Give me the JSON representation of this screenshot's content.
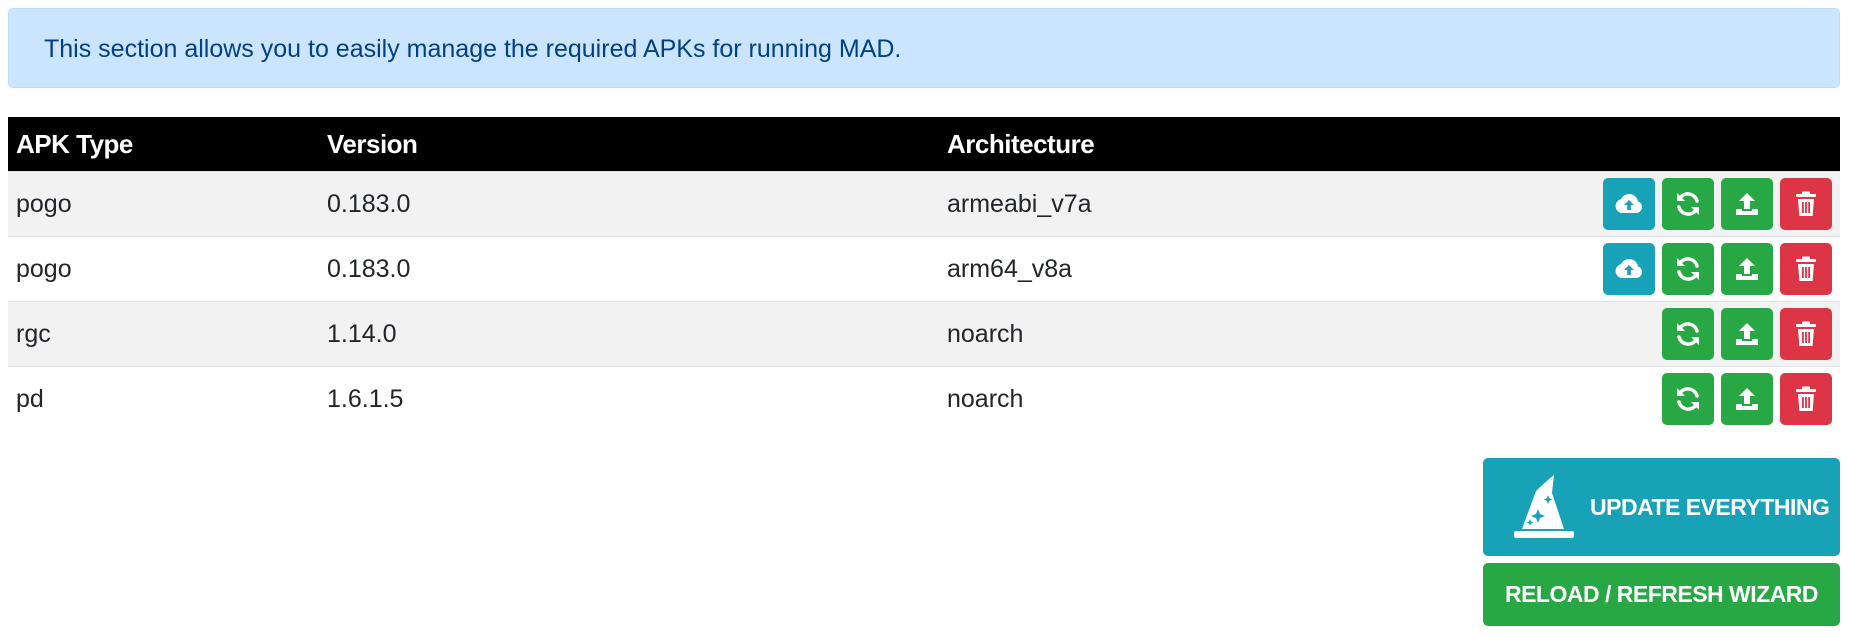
{
  "alert": {
    "text": "This section allows you to easily manage the required APKs for running MAD."
  },
  "table": {
    "headers": [
      "APK Type",
      "Version",
      "Architecture",
      ""
    ],
    "rows": [
      {
        "type": "pogo",
        "version": "0.183.0",
        "arch": "armeabi_v7a",
        "has_download": true
      },
      {
        "type": "pogo",
        "version": "0.183.0",
        "arch": "arm64_v8a",
        "has_download": true
      },
      {
        "type": "rgc",
        "version": "1.14.0",
        "arch": "noarch",
        "has_download": false
      },
      {
        "type": "pd",
        "version": "1.6.1.5",
        "arch": "noarch",
        "has_download": false
      }
    ]
  },
  "buttons": {
    "update_all": "UPDATE EVERYTHING",
    "reload_wizard": "RELOAD / REFRESH WIZARD"
  },
  "icons": {
    "download": "cloud-upload-icon",
    "refresh": "refresh-icon",
    "upload": "upload-icon",
    "delete": "trash-icon",
    "wizard": "wizard-hat-icon"
  },
  "colors": {
    "alert_bg": "#cce5ff",
    "alert_text": "#004085",
    "info": "#17a2b8",
    "success": "#28a745",
    "danger": "#dc3545",
    "header_bg": "#000000"
  }
}
